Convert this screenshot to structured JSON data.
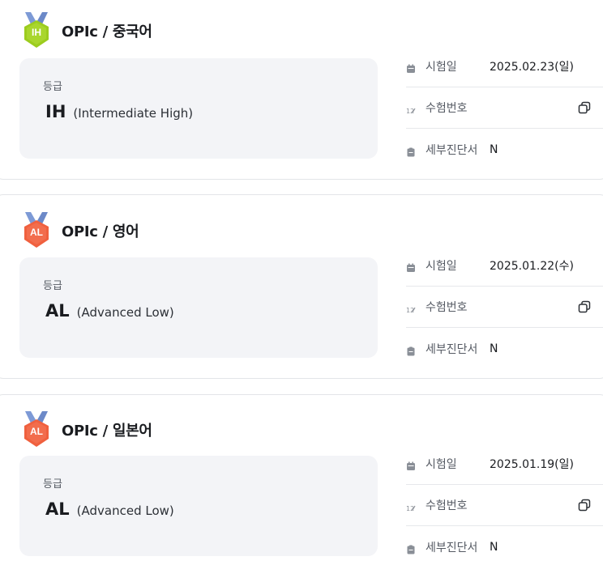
{
  "labels": {
    "grade": "등급",
    "test_date": "시험일",
    "exam_number": "수험번호",
    "diagnosis": "세부진단서"
  },
  "icons": {
    "date": "calendar-icon",
    "number": "number-icon",
    "diagnosis": "report-icon",
    "copy": "copy-icon"
  },
  "colors": {
    "IH_medal": "#9ccc1e",
    "AL_medal": "#f0603e",
    "ribbon": "#7d9ad6"
  },
  "results": [
    {
      "title": "OPIc / 중국어",
      "medal": "IH",
      "grade_code": "IH",
      "grade_desc": "(Intermediate High)",
      "test_date": "2025.02.23(일)",
      "exam_number": "",
      "diagnosis": "N"
    },
    {
      "title": "OPIc / 영어",
      "medal": "AL",
      "grade_code": "AL",
      "grade_desc": "(Advanced Low)",
      "test_date": "2025.01.22(수)",
      "exam_number": "",
      "diagnosis": "N"
    },
    {
      "title": "OPIc / 일본어",
      "medal": "AL",
      "grade_code": "AL",
      "grade_desc": "(Advanced Low)",
      "test_date": "2025.01.19(일)",
      "exam_number": "",
      "diagnosis": "N"
    }
  ]
}
